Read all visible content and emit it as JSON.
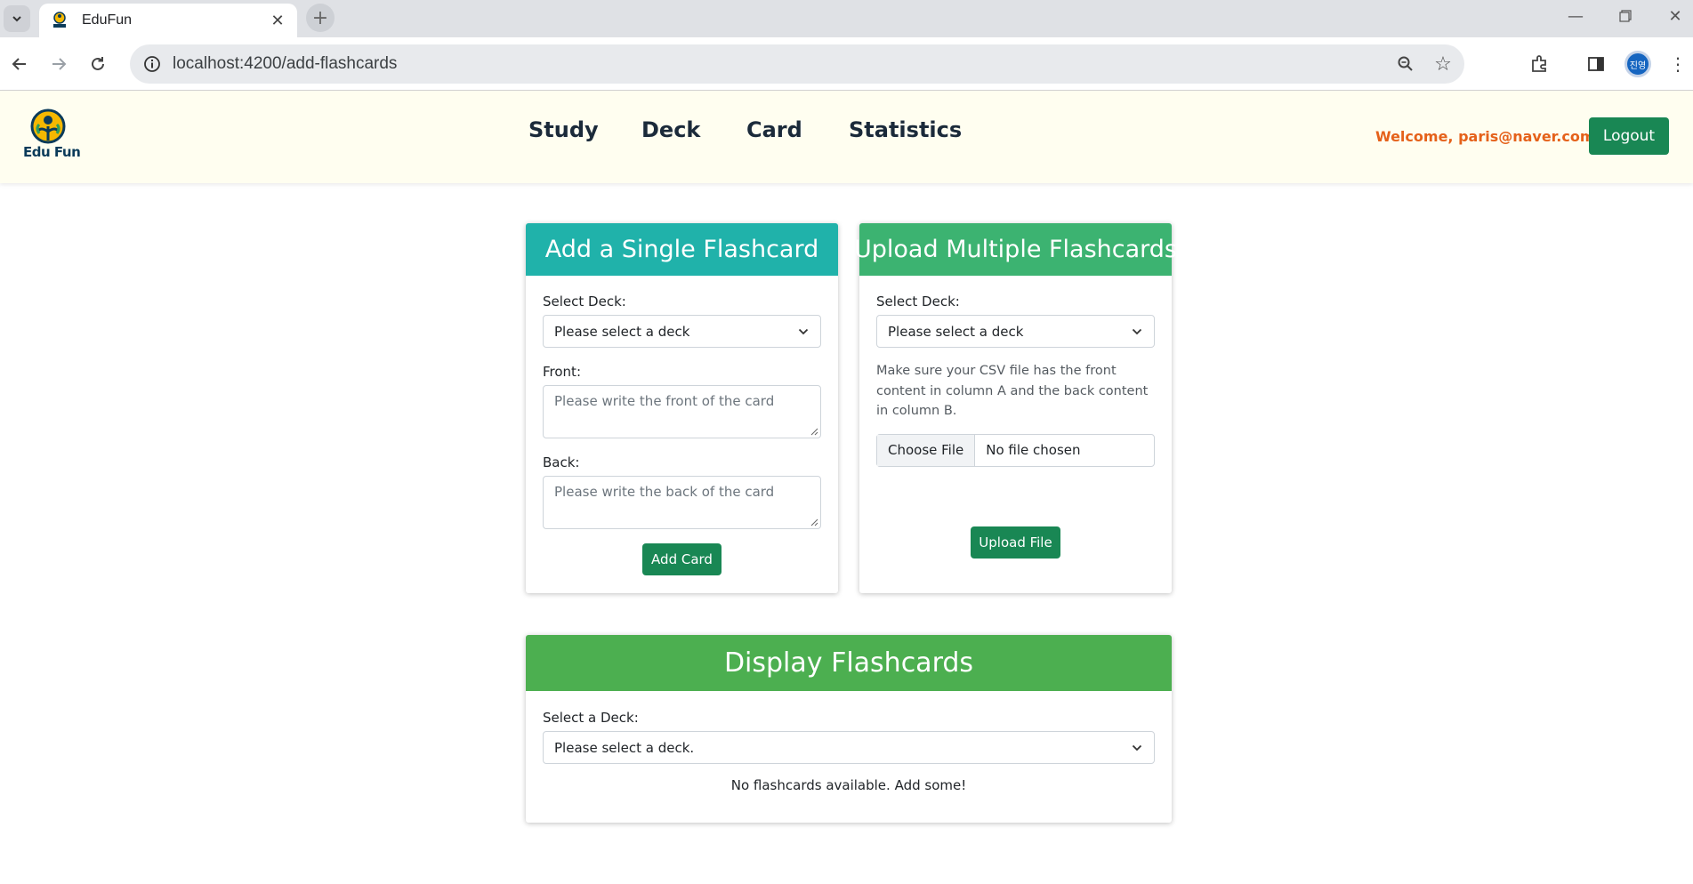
{
  "browser": {
    "tab_title": "EduFun",
    "url": "localhost:4200/add-flashcards",
    "profile_initials": "진영"
  },
  "app": {
    "logo_text": "Edu Fun",
    "nav": [
      "Study",
      "Deck",
      "Card",
      "Statistics"
    ],
    "welcome": "Welcome, paris@naver.com!",
    "logout": "Logout"
  },
  "single_card": {
    "title": "Add a Single Flashcard",
    "deck_label": "Select Deck:",
    "deck_value": "Please select a deck",
    "front_label": "Front:",
    "front_placeholder": "Please write the front of the card",
    "back_label": "Back:",
    "back_placeholder": "Please write the back of the card",
    "submit": "Add Card",
    "header_color": "#20b2aa"
  },
  "upload_cards": {
    "title": "Upload Multiple Flashcards",
    "deck_label": "Select Deck:",
    "deck_value": "Please select a deck",
    "note": "Make sure your CSV file has the front content in column A and the back content in column B.",
    "choose_file": "Choose File",
    "file_status": "No file chosen",
    "submit": "Upload File",
    "header_color": "#3cb371"
  },
  "display_cards": {
    "title": "Display Flashcards",
    "deck_label": "Select a Deck:",
    "deck_value": "Please select a deck.",
    "empty_message": "No flashcards available. Add some!",
    "header_color": "#4caf50"
  }
}
